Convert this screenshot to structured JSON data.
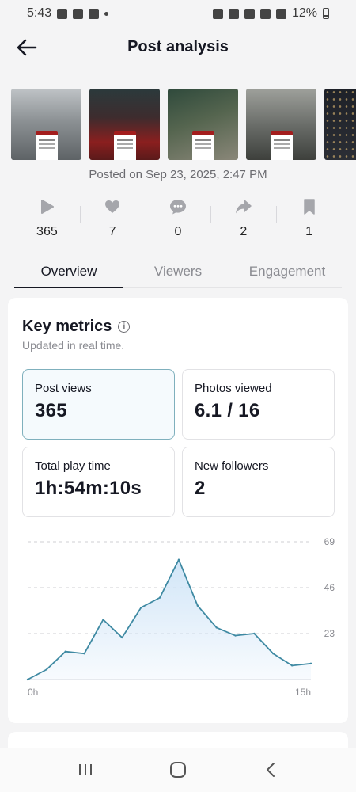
{
  "status_bar": {
    "time": "5:43",
    "battery": "12%"
  },
  "header": {
    "title": "Post analysis"
  },
  "posted_on": "Posted on Sep 23, 2025, 2:47 PM",
  "stats": [
    {
      "icon": "play-icon",
      "value": "365"
    },
    {
      "icon": "heart-icon",
      "value": "7"
    },
    {
      "icon": "comment-icon",
      "value": "0"
    },
    {
      "icon": "share-icon",
      "value": "2"
    },
    {
      "icon": "bookmark-icon",
      "value": "1"
    }
  ],
  "tabs": [
    {
      "label": "Overview",
      "active": true
    },
    {
      "label": "Viewers",
      "active": false
    },
    {
      "label": "Engagement",
      "active": false
    }
  ],
  "key_metrics": {
    "title": "Key metrics",
    "subtitle": "Updated in real time.",
    "metrics": [
      {
        "label": "Post views",
        "value": "365",
        "selected": true
      },
      {
        "label": "Photos viewed",
        "value": "6.1 / 16",
        "selected": false
      },
      {
        "label": "Total play time",
        "value": "1h:54m:10s",
        "selected": false
      },
      {
        "label": "New followers",
        "value": "2",
        "selected": false
      }
    ]
  },
  "chart_data": {
    "type": "area",
    "title": "",
    "xlabel": "",
    "ylabel": "",
    "x": [
      "0h",
      "1h",
      "2h",
      "3h",
      "4h",
      "5h",
      "6h",
      "7h",
      "8h",
      "9h",
      "10h",
      "11h",
      "12h",
      "13h",
      "14h",
      "15h"
    ],
    "x_tick_labels": [
      "0h",
      "15h"
    ],
    "y_ticks": [
      23,
      46,
      69
    ],
    "ylim": [
      0,
      69
    ],
    "grid": true,
    "series": [
      {
        "values": [
          0,
          5,
          14,
          13,
          30,
          21,
          36,
          41,
          60,
          37,
          26,
          22,
          23,
          13,
          7,
          8
        ]
      }
    ],
    "colors": {
      "line": "#3f8aa3",
      "fill": "#cfe4f7",
      "grid": "#cfcfd3"
    }
  }
}
